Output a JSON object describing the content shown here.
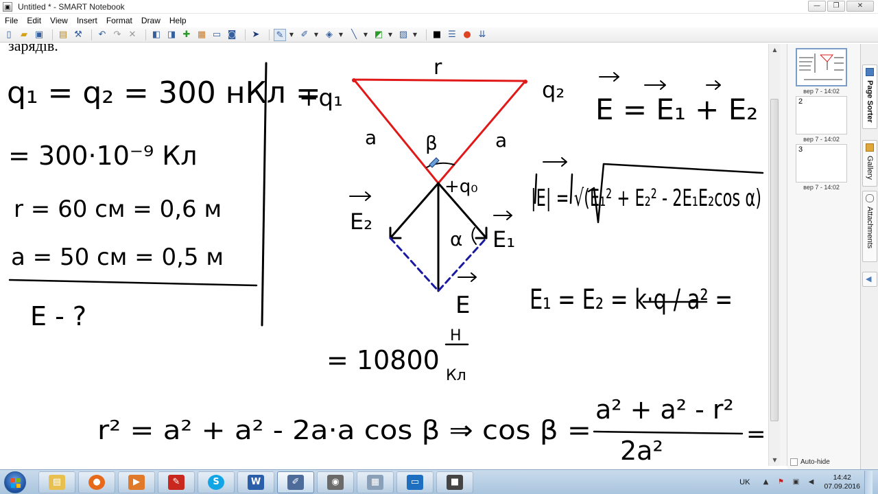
{
  "window": {
    "title": "Untitled * - SMART Notebook",
    "minimize": "—",
    "maximize": "❐",
    "close": "✕"
  },
  "menu": [
    "File",
    "Edit",
    "View",
    "Insert",
    "Format",
    "Draw",
    "Help"
  ],
  "toolbar": {
    "icons": [
      "new-page-icon",
      "open-icon",
      "save-icon",
      "paste-icon",
      "properties-icon",
      "undo-icon",
      "redo-icon",
      "delete-icon",
      "previous-page-icon",
      "next-page-icon",
      "add-page-icon",
      "screen-shade-icon",
      "full-screen-icon",
      "capture-icon",
      "select-icon",
      "pen-icon",
      "creative-pen-icon",
      "eraser-icon",
      "line-icon",
      "shape-icon",
      "fill-icon",
      "text-icon",
      "color-icon",
      "line-style-icon",
      "transparency-icon"
    ]
  },
  "canvas": {
    "heading_fragment": "зарядів.",
    "given": {
      "q": "q₁ = q₂ = 300 нКл =",
      "q_cont": "= 300·10⁻⁹ Кл",
      "r": "r = 60 см = 0,6 м",
      "a": "a = 50 см = 0,5 м",
      "find": "E - ?"
    },
    "diagram": {
      "q1": "+q₁",
      "q2": "q₂",
      "r": "r",
      "a_left": "a",
      "a_right": "a",
      "beta": "β",
      "q0": "+q₀",
      "E1": "E₁",
      "E2": "E₂",
      "E": "E",
      "alpha": "α"
    },
    "formulas": {
      "superposition": "E = E₁ + E₂",
      "magnitude": "|E| = √(E₁² + E₂² - 2E₁E₂cos α)",
      "field": "E₁ = E₂ = k·q / a² =",
      "result_value": "= 10800",
      "result_unit_top": "Н",
      "result_unit_bottom": "Кл",
      "cosine_law": "r² = a² + a² - 2a·a cos β  ⇒  cos β =",
      "cos_num": "a² + a² - r²",
      "cos_den": "2a²",
      "cos_eq": "="
    }
  },
  "side_panel": {
    "pages": [
      {
        "num": "",
        "label": "вер 7 - 14:02",
        "selected": true
      },
      {
        "num": "2",
        "label": "вер 7 - 14:02",
        "selected": false
      },
      {
        "num": "3",
        "label": "вер 7 - 14:02",
        "selected": false
      }
    ],
    "autohide": "Auto-hide",
    "tabs": [
      "Page Sorter",
      "Gallery",
      "Attachments"
    ]
  },
  "taskbar": {
    "apps": [
      "explorer-icon",
      "firefox-icon",
      "media-player-icon",
      "acrobat-icon",
      "skype-icon",
      "word-icon",
      "smart-notebook-icon",
      "camera-icon",
      "calculator-icon",
      "display-icon",
      "video-icon"
    ],
    "tray": {
      "lang": "UK",
      "time": "14:42",
      "date": "07.09.2016"
    }
  },
  "colors": {
    "ink": "#000000",
    "triangle": "#e01818",
    "parallelogram": "#1a1aa0",
    "selection": "#7a9cc8"
  }
}
